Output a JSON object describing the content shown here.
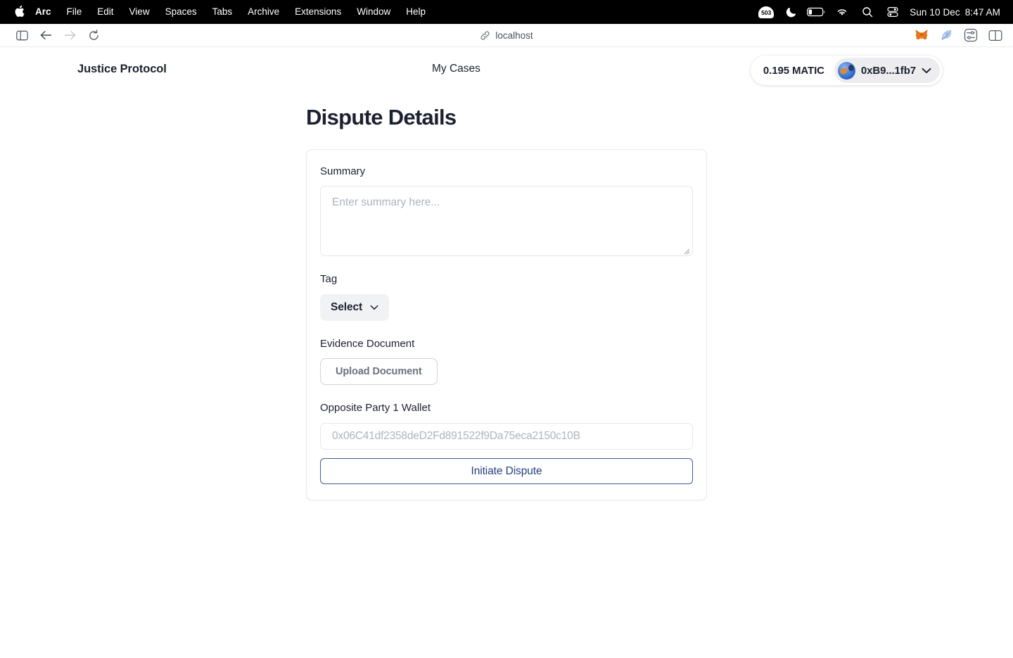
{
  "menubar": {
    "apple_icon": "apple-logo-icon",
    "items": [
      "Arc",
      "File",
      "Edit",
      "View",
      "Spaces",
      "Tabs",
      "Archive",
      "Extensions",
      "Window",
      "Help"
    ],
    "status_icons": [
      "tab-counter-503-icon",
      "moon-icon",
      "battery-icon",
      "wifi-icon",
      "search-icon",
      "control-center-icon"
    ],
    "tab_counter": "503",
    "date": "Sun 10 Dec",
    "time": "8:47 AM"
  },
  "browser": {
    "sidebar_toggle_icon": "sidebar-toggle-icon",
    "back_icon": "back-arrow-icon",
    "forward_icon": "forward-arrow-icon",
    "reload_icon": "reload-icon",
    "link_icon": "link-icon",
    "url": "localhost",
    "extensions": [
      "metamask-fox-icon",
      "feather-icon",
      "sliders-icon",
      "split-view-icon"
    ]
  },
  "app": {
    "brand": "Justice Protocol",
    "nav_link": "My Cases",
    "wallet": {
      "balance": "0.195 MATIC",
      "avatar_icon": "wallet-avatar-icon",
      "address": "0xB9...1fb7",
      "chevron_icon": "chevron-down-icon"
    }
  },
  "main": {
    "title": "Dispute Details",
    "form": {
      "summary_label": "Summary",
      "summary_value": "",
      "summary_placeholder": "Enter summary here...",
      "tag_label": "Tag",
      "tag_selected": "Select",
      "tag_chevron_icon": "chevron-down-icon",
      "evidence_label": "Evidence Document",
      "upload_button": "Upload Document",
      "wallet_label": "Opposite Party 1 Wallet",
      "wallet_value": "",
      "wallet_placeholder": "0x06C41df2358deD2Fd891522f9Da75eca2150c10B",
      "submit_button": "Initiate Dispute"
    }
  },
  "colors": {
    "accent": "#24407c",
    "accent_border": "#3f5d95",
    "text": "#1d2130",
    "placeholder": "#aeb3c0",
    "chip_bg": "#f1f2f4"
  }
}
